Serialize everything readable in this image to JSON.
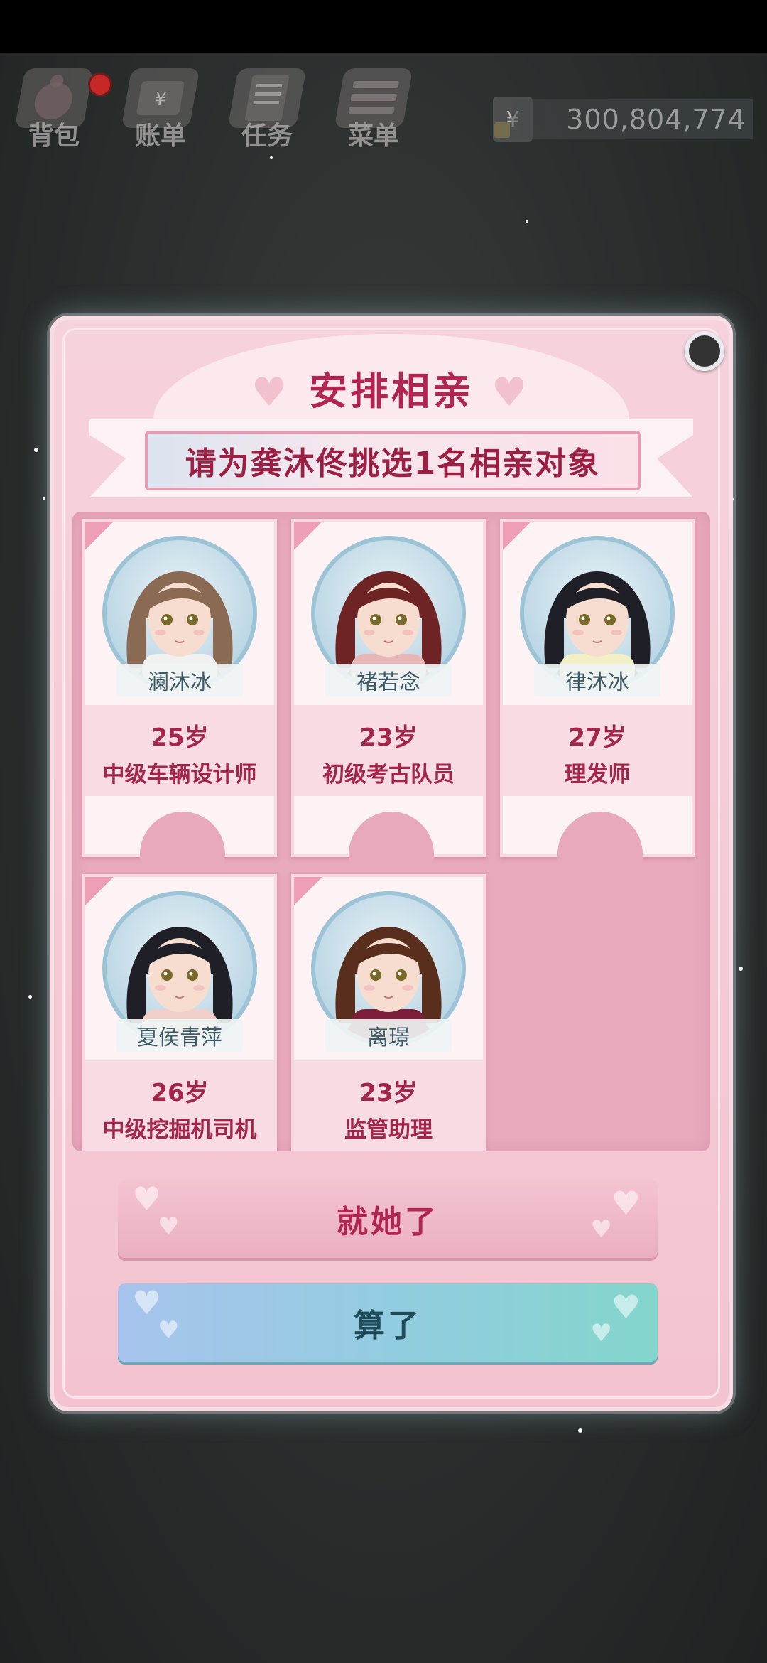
{
  "topbar": {
    "items": [
      {
        "label": "背包",
        "icon": "backpack-icon"
      },
      {
        "label": "账单",
        "icon": "bill-icon"
      },
      {
        "label": "任务",
        "icon": "task-icon"
      },
      {
        "label": "菜单",
        "icon": "menu-icon"
      }
    ],
    "currency_symbol": "¥",
    "money": "300,804,774"
  },
  "dialog": {
    "title": "安排相亲",
    "subtitle": "请为龚沐佟挑选1名相亲对象",
    "confirm_label": "就她了",
    "cancel_label": "算了"
  },
  "candidates": [
    {
      "name": "澜沐冰",
      "age": "25岁",
      "job": "中级车辆设计师",
      "hair": "#8a6a52",
      "top": "#f1f1f1"
    },
    {
      "name": "褚若念",
      "age": "23岁",
      "job": "初级考古队员",
      "hair": "#6e2424",
      "top": "#e7b7b7"
    },
    {
      "name": "律沐冰",
      "age": "27岁",
      "job": "理发师",
      "hair": "#1f1f28",
      "top": "#f3f0c6"
    },
    {
      "name": "夏侯青萍",
      "age": "26岁",
      "job": "中级挖掘机司机",
      "hair": "#1f1f28",
      "top": "#f0d0c8"
    },
    {
      "name": "离璟",
      "age": "23岁",
      "job": "监管助理",
      "hair": "#5a2e1c",
      "top": "#7b1f3a"
    }
  ],
  "colors": {
    "accent": "#b02650",
    "card_text": "#a3254a",
    "panel": "#e8a9bc"
  }
}
